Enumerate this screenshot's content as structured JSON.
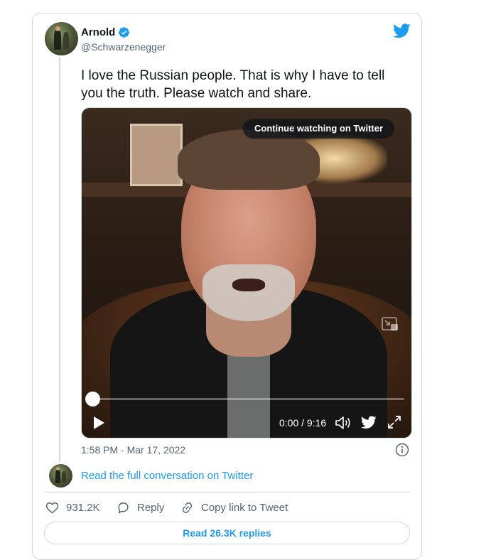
{
  "author": {
    "name": "Arnold",
    "handle": "@Schwarzenegger",
    "verified": true
  },
  "tweet": {
    "text": "I love the Russian people. That is why I have to tell you the truth. Please watch and share.",
    "timestamp": "1:58 PM · Mar 17, 2022"
  },
  "video": {
    "continue_label": "Continue watching on Twitter",
    "time_display": "0:00 / 9:16",
    "progress": 0.0
  },
  "conversation_link": "Read the full conversation on Twitter",
  "actions": {
    "likes": "931.2K",
    "reply_label": "Reply",
    "copy_link_label": "Copy link to Tweet"
  },
  "replies_button": "Read 26.3K replies",
  "colors": {
    "accent": "#1d9bf0",
    "secondary_text": "#536471",
    "border": "#cfd9de"
  },
  "icons": [
    "twitter-bird-icon",
    "verified-badge-icon",
    "play-icon",
    "volume-icon",
    "fullscreen-icon",
    "pip-icon",
    "info-icon",
    "heart-icon",
    "reply-icon",
    "link-icon"
  ]
}
